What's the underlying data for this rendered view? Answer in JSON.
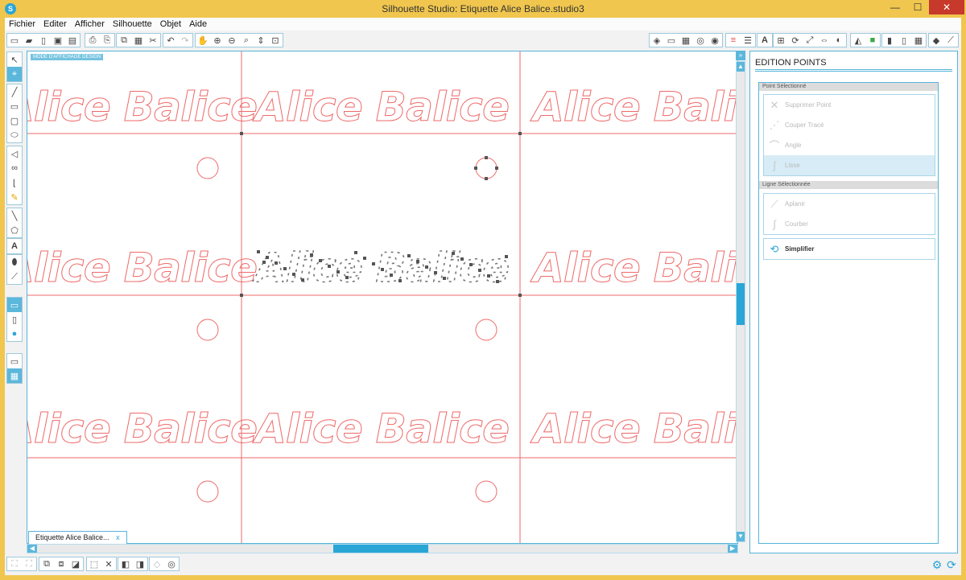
{
  "window": {
    "title": "Silhouette Studio: Etiquette Alice Balice.studio3",
    "app_icon": "S",
    "minimize": "—",
    "maximize": "☐",
    "close": "✕"
  },
  "menu": [
    "Fichier",
    "Editer",
    "Afficher",
    "Silhouette",
    "Objet",
    "Aide"
  ],
  "canvas": {
    "mode_label": "MODE D'AFFICHAGE DESIGN",
    "label_text": "Alice Balice",
    "cut_line_color": "#ee6a6a"
  },
  "document_tab": {
    "label": "Etiquette Alice Balice...",
    "close": "x"
  },
  "panel": {
    "title": "EDITION POINTS",
    "point_section": {
      "header": "Point Sélectionné",
      "items": [
        {
          "label": "Supprimer Point",
          "icon": "x-cross-icon"
        },
        {
          "label": "Couper Tracé",
          "icon": "cut-path-icon"
        },
        {
          "label": "Angle",
          "icon": "corner-icon"
        },
        {
          "label": "Lisse",
          "icon": "smooth-icon"
        }
      ]
    },
    "line_section": {
      "header": "Ligne Sélectionnée",
      "items": [
        {
          "label": "Aplanir",
          "icon": "straighten-icon"
        },
        {
          "label": "Courber",
          "icon": "curve-icon"
        }
      ]
    },
    "simplify": {
      "label": "Simplifier",
      "icon": "simplify-icon"
    }
  },
  "colors": {
    "accent": "#2aa6d6",
    "title_bar": "#f0c64e",
    "close_button": "#c7392b"
  }
}
